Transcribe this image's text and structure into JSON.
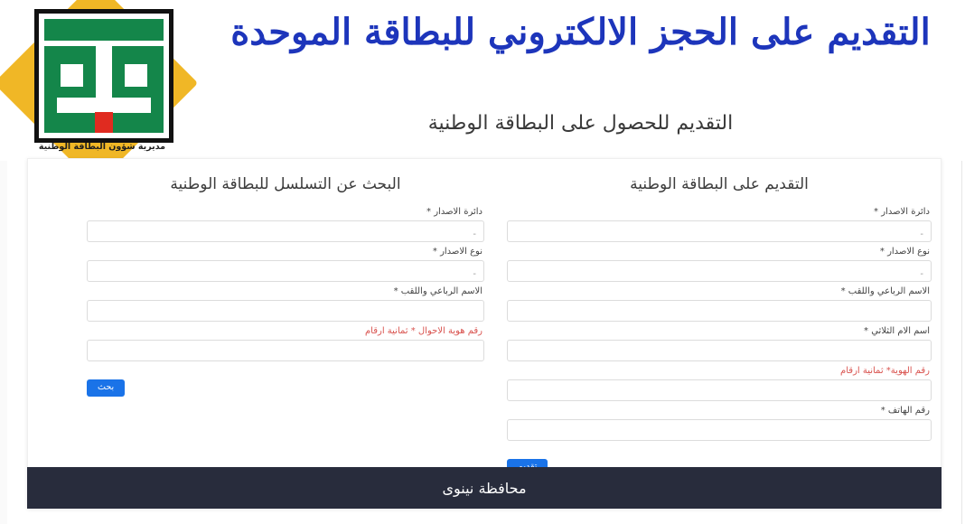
{
  "header": {
    "title": "التقديم على الحجز الالكتروني للبطاقة الموحدة",
    "subtitle": "التقديم للحصول على البطاقة الوطنية",
    "title_color": "#1d35bb",
    "logo": {
      "caption": "مديرية شؤون البطاقة الوطنية",
      "diamond_color": "#f0b726",
      "emblem_green": "#14864a",
      "emblem_red": "#e02b20",
      "emblem_border": "#111111"
    }
  },
  "apply_panel": {
    "title": "التقديم على البطاقة الوطنية",
    "fields": [
      {
        "label": "دائرة الاصدار *",
        "type": "select",
        "value": "-",
        "red": false
      },
      {
        "label": "نوع الاصدار *",
        "type": "select",
        "value": "-",
        "red": false
      },
      {
        "label": "الاسم الرباعي واللقب *",
        "type": "input",
        "value": "",
        "red": false
      },
      {
        "label": "اسم الام الثلاثي *",
        "type": "input",
        "value": "",
        "red": false
      },
      {
        "label": "رقم الهوية* ثمانية ارقام",
        "type": "input",
        "value": "",
        "red": true
      },
      {
        "label": "رقم الهاتف *",
        "type": "input",
        "value": "",
        "red": false
      }
    ],
    "submit_label": "تقديم"
  },
  "search_panel": {
    "title": "البحث عن التسلسل للبطاقة الوطنية",
    "fields": [
      {
        "label": "دائرة الاصدار *",
        "type": "select",
        "value": "-",
        "red": false
      },
      {
        "label": "نوع الاصدار *",
        "type": "select",
        "value": "-",
        "red": false
      },
      {
        "label": "الاسم الرباعي واللقب *",
        "type": "input",
        "value": "",
        "red": false
      },
      {
        "label": "رقم هوية الاحوال * ثمانية ارقام",
        "type": "input",
        "value": "",
        "red": true
      }
    ],
    "search_label": "بحث"
  },
  "footer": {
    "text": "محافظة نينوى",
    "background": "#282c3c"
  },
  "theme": {
    "button_blue": "#1a73e8",
    "label_red": "#d9534f"
  }
}
